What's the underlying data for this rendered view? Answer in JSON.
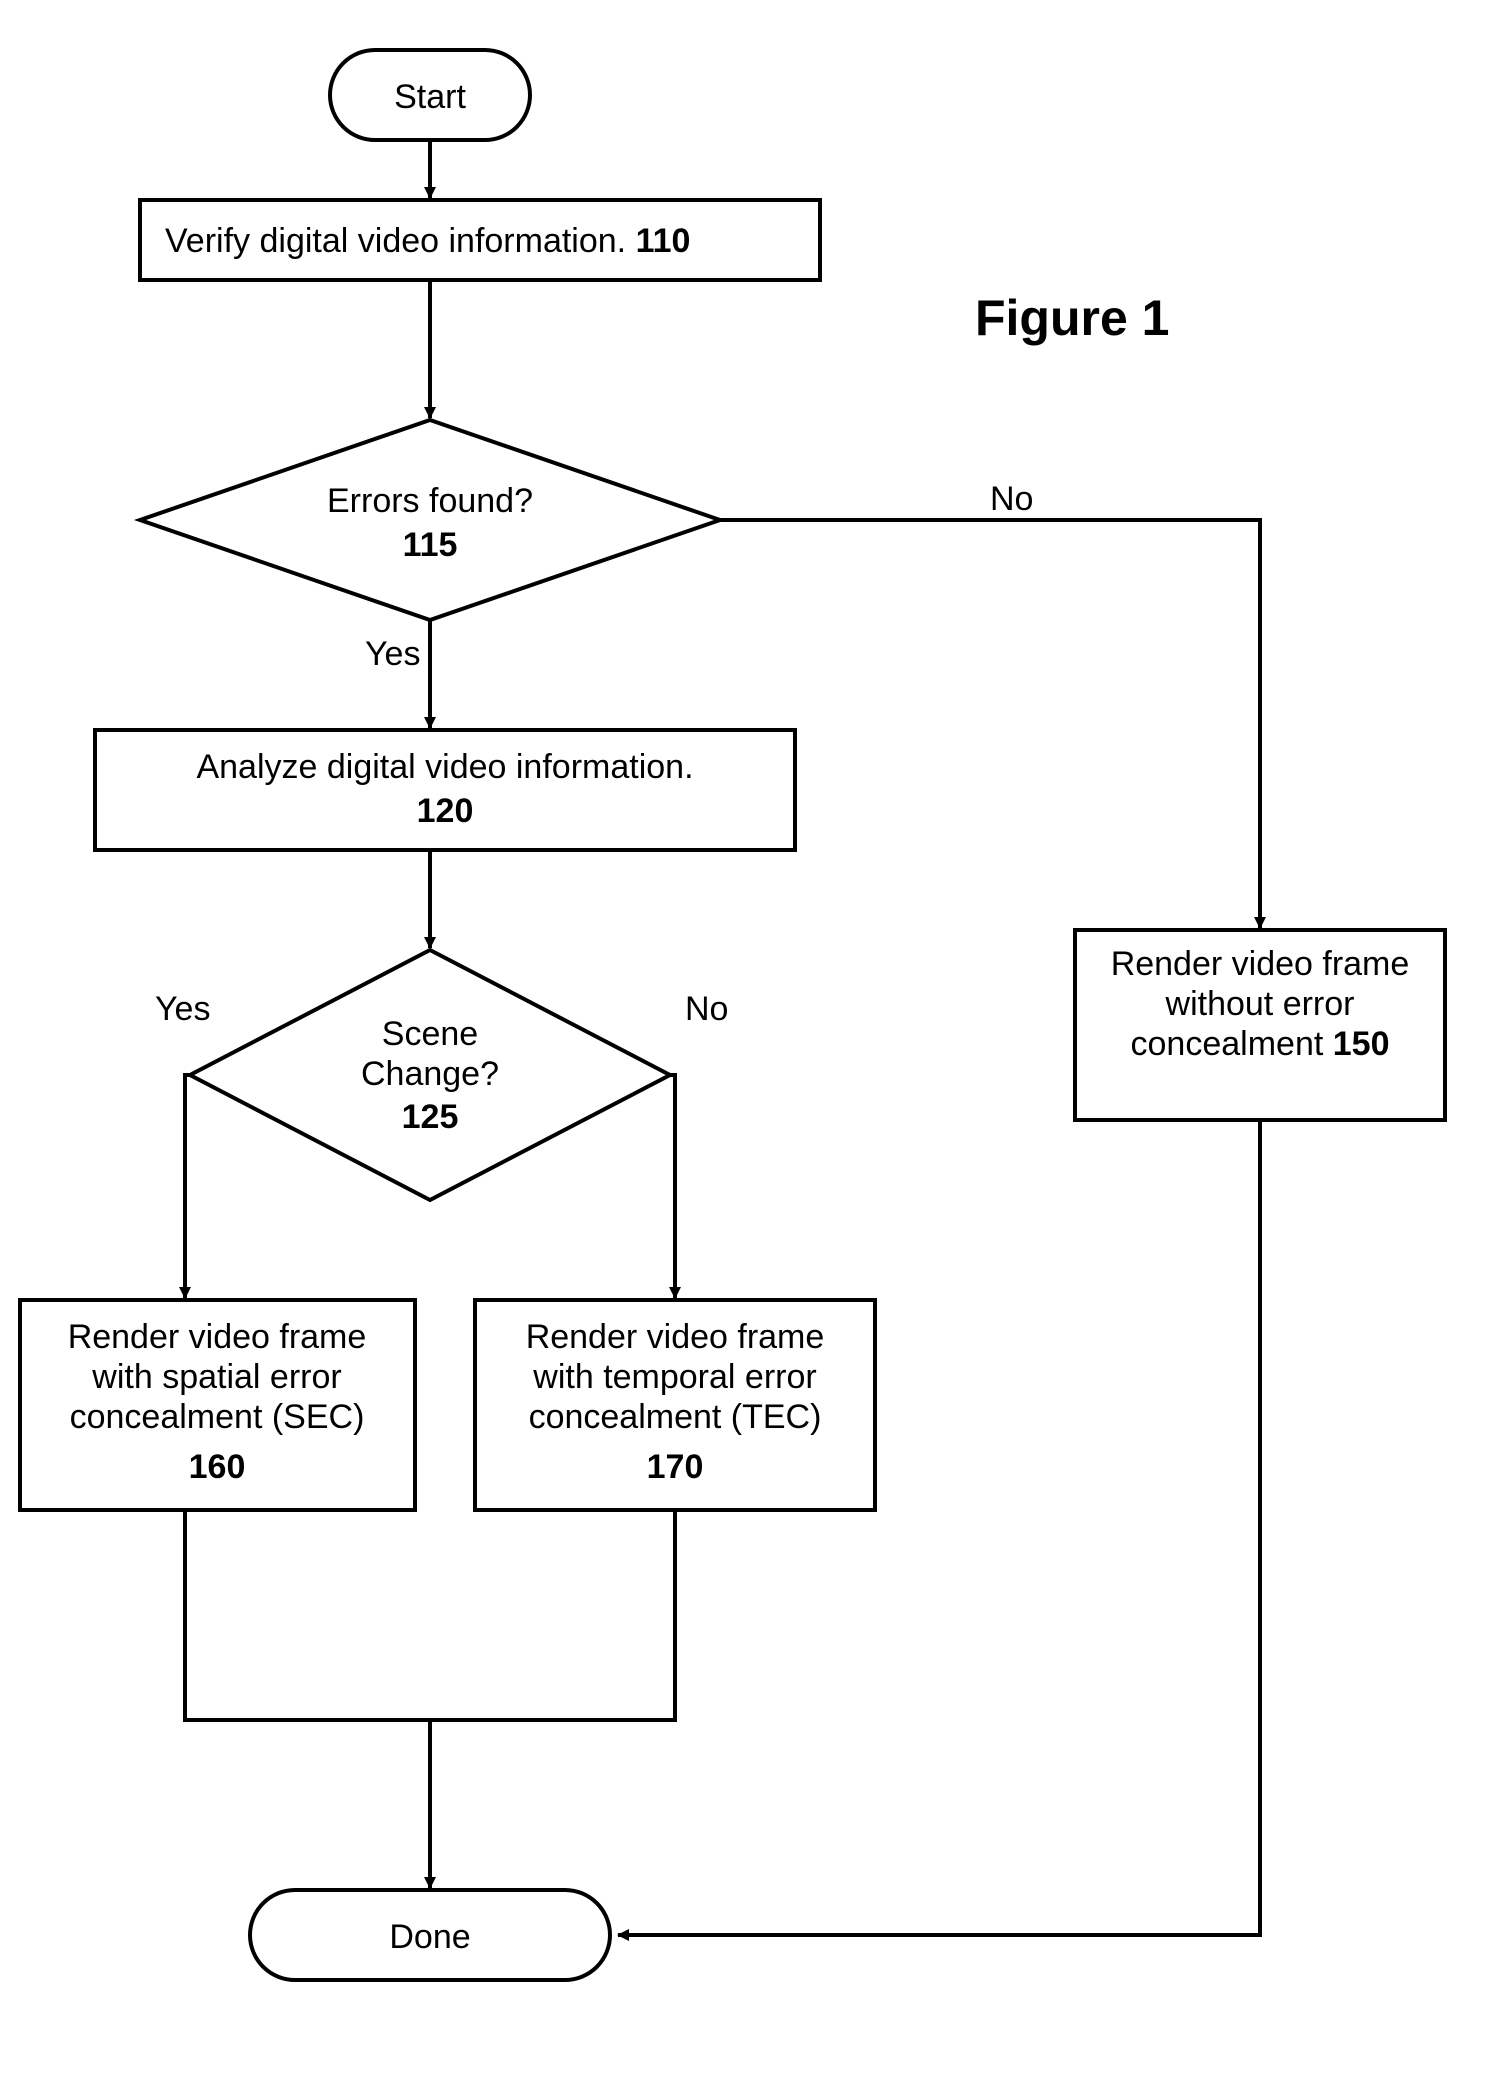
{
  "title": "Figure 1",
  "nodes": {
    "start": {
      "label": "Start"
    },
    "verify": {
      "text": "Verify digital video information.",
      "ref": "110"
    },
    "errors": {
      "text": "Errors found?",
      "ref": "115",
      "yes": "Yes",
      "no": "No"
    },
    "analyze": {
      "text": "Analyze digital video information.",
      "ref": "120"
    },
    "scene": {
      "text1": "Scene",
      "text2": "Change?",
      "ref": "125",
      "yes": "Yes",
      "no": "No"
    },
    "render_no_ec": {
      "l1": "Render video frame",
      "l2": "without error",
      "l3": "concealment ",
      "ref": "150"
    },
    "render_sec": {
      "l1": "Render video frame",
      "l2": "with spatial error",
      "l3": "concealment (SEC)",
      "ref": "160"
    },
    "render_tec": {
      "l1": "Render video frame",
      "l2": "with temporal error",
      "l3": "concealment (TEC)",
      "ref": "170"
    },
    "done": {
      "label": "Done"
    }
  }
}
